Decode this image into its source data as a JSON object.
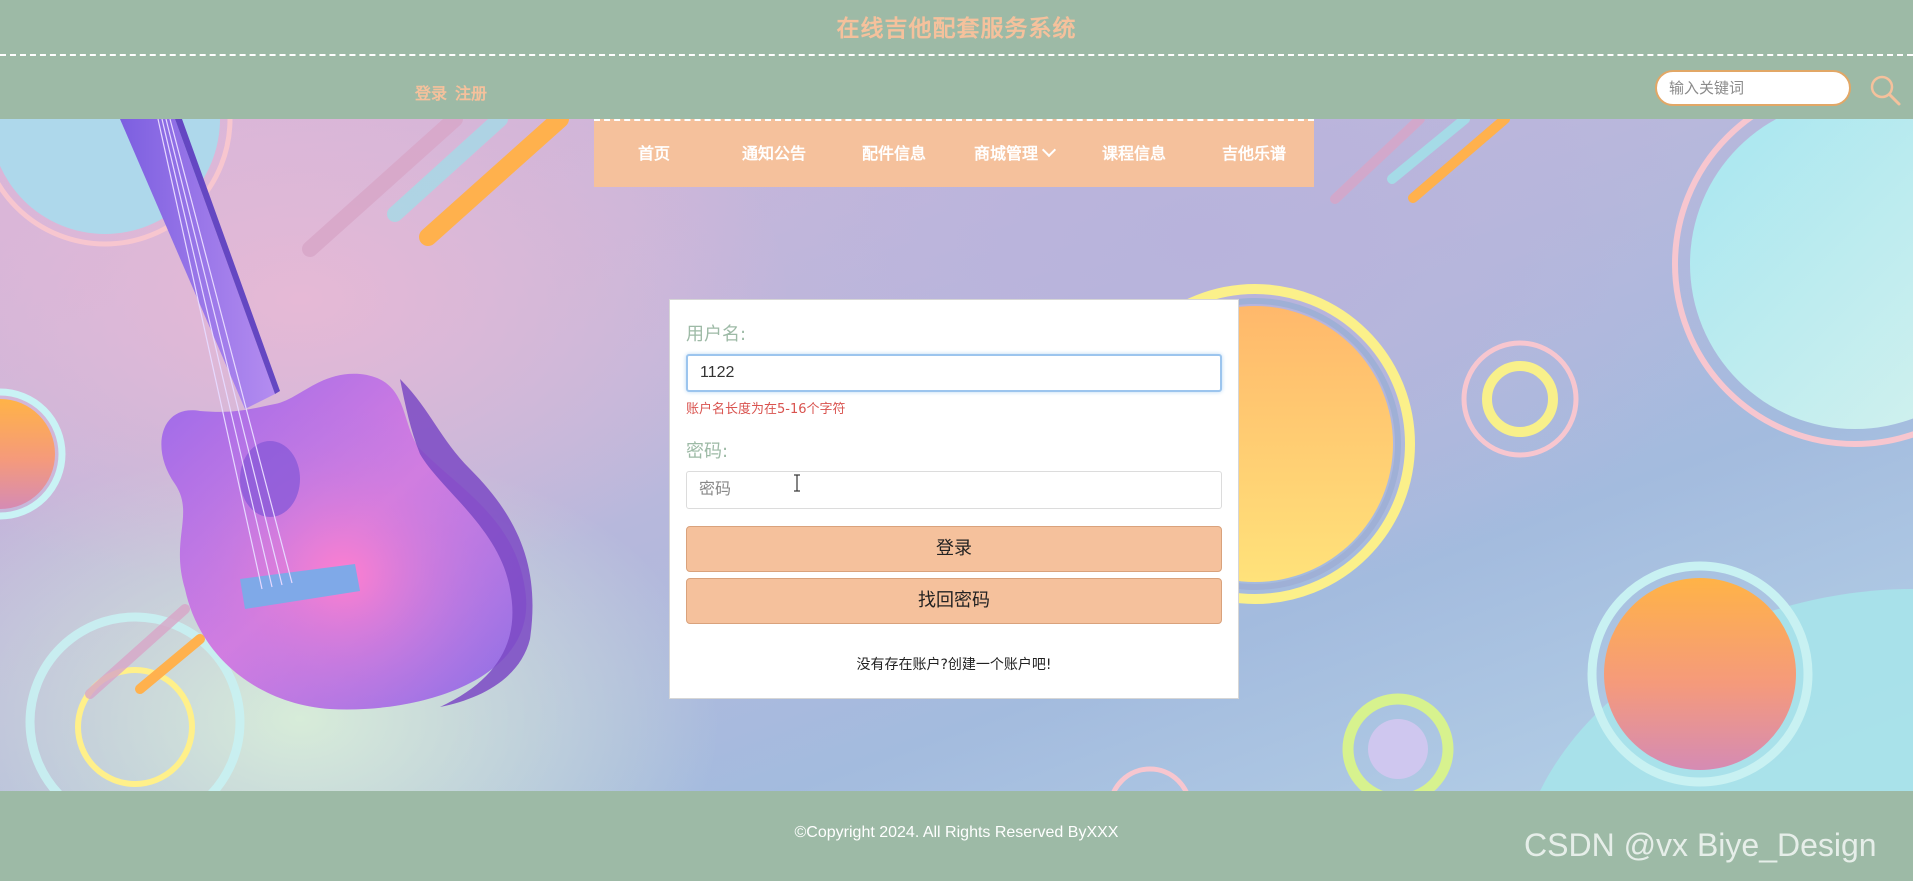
{
  "header": {
    "site_title": "在线吉他配套服务系统",
    "auth_links": [
      "登录",
      "注册"
    ],
    "search": {
      "placeholder": "输入关键词",
      "icon": "search-icon"
    }
  },
  "nav": {
    "items": [
      {
        "label": "首页"
      },
      {
        "label": "通知公告"
      },
      {
        "label": "配件信息"
      },
      {
        "label": "商城管理",
        "has_dropdown": true
      },
      {
        "label": "课程信息"
      },
      {
        "label": "吉他乐谱"
      }
    ]
  },
  "login": {
    "username_label": "用户名:",
    "username_value": "1122",
    "username_error": "账户名长度为在5-16个字符",
    "password_label": "密码:",
    "password_placeholder": "密码",
    "login_button": "登录",
    "recover_button": "找回密码",
    "signup_text": "没有存在账户?创建一个账户吧!"
  },
  "footer": {
    "copyright": "©Copyright 2024. All Rights Reserved ByXXX",
    "watermark": "CSDN @vx Biye_Design"
  },
  "colors": {
    "header_bg": "#9dbaa6",
    "accent_peach": "#f5c19c",
    "label_green": "#9dbaa6",
    "error_red": "#d9534f",
    "input_focus": "#9cc5ee"
  }
}
